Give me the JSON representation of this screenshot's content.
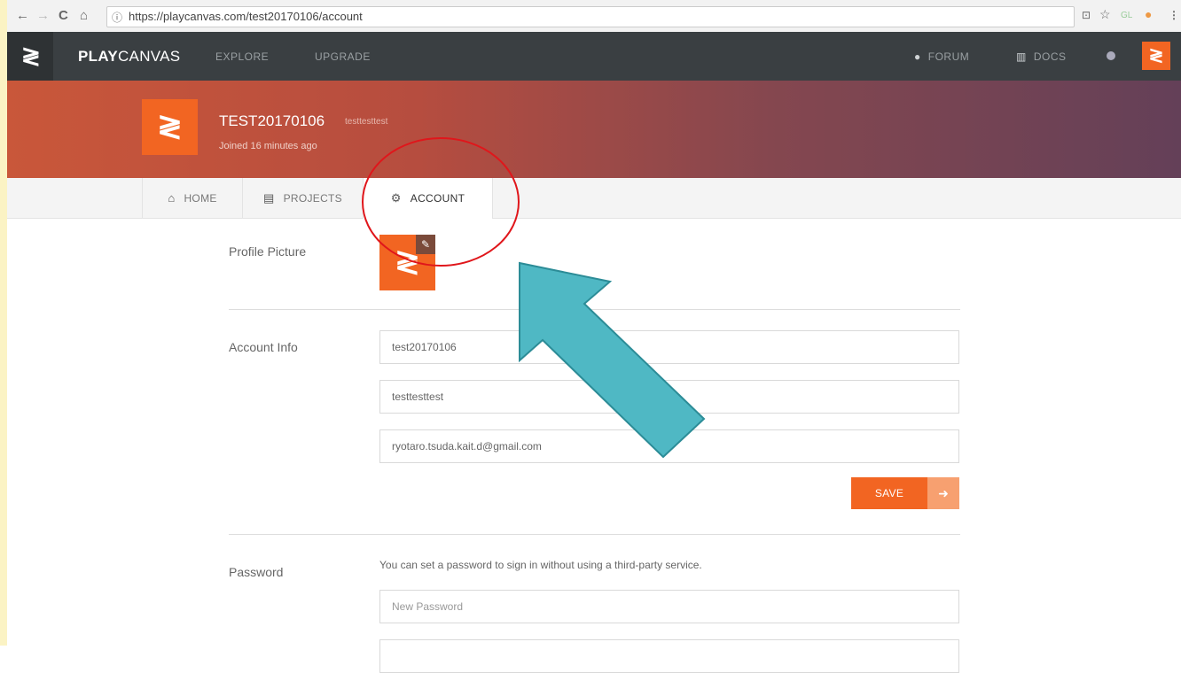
{
  "browser": {
    "back": "←",
    "forward": "→",
    "reload": "C",
    "home": "⌂",
    "info": "ⓘ",
    "url": "https://playcanvas.com/test20170106/account",
    "ext_translate": "⊡",
    "ext_star": "☆",
    "ext_gl": "GL",
    "ext_color": "●",
    "menu": "⋮"
  },
  "topnav": {
    "logo": "≷",
    "brand_bold": "PLAY",
    "brand_rest": "CANVAS",
    "explore": "EXPLORE",
    "upgrade": "UPGRADE",
    "forum_icon": "●",
    "forum": "FORUM",
    "docs_icon": "▥",
    "docs": "DOCS",
    "avatar": "≷"
  },
  "profile": {
    "avatar": "≷",
    "name": "TEST20170106",
    "subname": "testtesttest",
    "joined": "Joined 16 minutes ago"
  },
  "tabs": {
    "home_icon": "⌂",
    "home": "HOME",
    "projects_icon": "▤",
    "projects": "PROJECTS",
    "account_icon": "⚙",
    "account": "ACCOUNT"
  },
  "form": {
    "profile_picture_label": "Profile Picture",
    "profile_picture_glyph": "≷",
    "edit_icon": "✎",
    "account_info_label": "Account Info",
    "username_value": "test20170106",
    "fullname_value": "testtesttest",
    "email_value": "ryotaro.tsuda.kait.d@gmail.com",
    "save_label": "SAVE",
    "save_arrow": "➜",
    "password_label": "Password",
    "password_hint": "You can set a password to sign in without using a third-party service.",
    "new_password_placeholder": "New Password"
  },
  "colors": {
    "accent": "#f26522",
    "nav_bg": "#3a3f42",
    "annotation_red": "#e0161b",
    "annotation_arrow": "#4fb8c4"
  }
}
